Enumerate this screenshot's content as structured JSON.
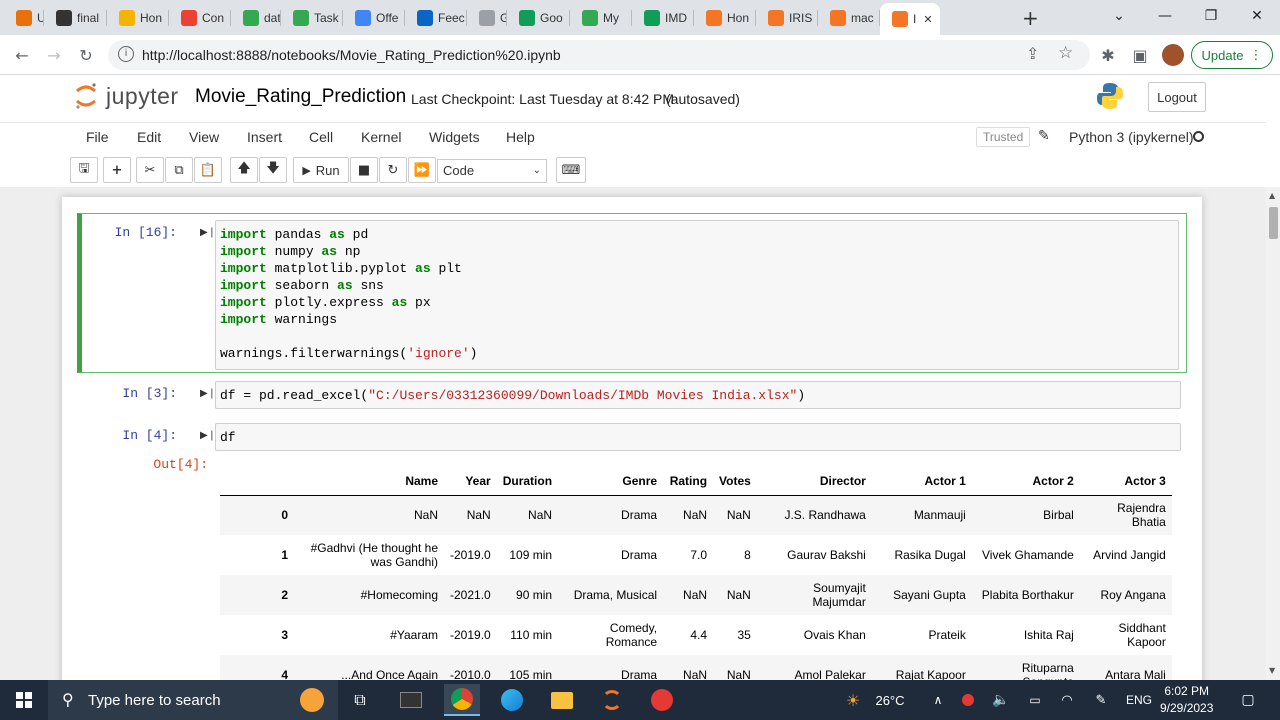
{
  "browser": {
    "tabs": [
      {
        "label": "Unti",
        "icon": "colab-icon",
        "color": "#e8710a"
      },
      {
        "label": "final",
        "icon": "github-icon",
        "color": "#333333"
      },
      {
        "label": "Hon",
        "icon": "sheet-icon",
        "color": "#f4b400"
      },
      {
        "label": "Con",
        "icon": "gmail-icon",
        "color": "#ea4335"
      },
      {
        "label": "data",
        "icon": "drive-icon",
        "color": "#34a853"
      },
      {
        "label": "Task",
        "icon": "drive-icon",
        "color": "#34a853"
      },
      {
        "label": "Offe",
        "icon": "drive-icon",
        "color": "#4285f4"
      },
      {
        "label": "Feec",
        "icon": "linkedin-icon",
        "color": "#0a66c2"
      },
      {
        "label": "Grou",
        "icon": "globe-icon",
        "color": "#9aa0a6"
      },
      {
        "label": "Goo",
        "icon": "google-sheets-icon",
        "color": "#0f9d58"
      },
      {
        "label": "My",
        "icon": "drive-icon",
        "color": "#34a853"
      },
      {
        "label": "IMD",
        "icon": "google-sheets-icon",
        "color": "#0f9d58"
      },
      {
        "label": "Hon",
        "icon": "jupyter-icon",
        "color": "#f37626"
      },
      {
        "label": "IRIS",
        "icon": "folder-icon",
        "color": "#f37626"
      },
      {
        "label": "mac",
        "icon": "folder-icon",
        "color": "#f37626"
      },
      {
        "label": "I",
        "icon": "folder-icon",
        "color": "#f37626"
      }
    ],
    "url": "http://localhost:8888/notebooks/Movie_Rating_Prediction%20.ipynb",
    "update_label": "Update"
  },
  "jupyter": {
    "logo_text": "jupyter",
    "notebook_name": "Movie_Rating_Prediction",
    "checkpoint": "Last Checkpoint: Last Tuesday at 8:42 PM",
    "autosave": "(autosaved)",
    "logout_label": "Logout",
    "menu": [
      "File",
      "Edit",
      "View",
      "Insert",
      "Cell",
      "Kernel",
      "Widgets",
      "Help"
    ],
    "trusted_label": "Trusted",
    "kernel_name": "Python 3 (ipykernel)",
    "run_label": "Run",
    "cell_type": "Code"
  },
  "cells": {
    "c1": {
      "prompt": "In [16]:"
    },
    "c2": {
      "prompt": "In [3]:"
    },
    "c3": {
      "prompt": "In [4]:",
      "code": "df",
      "out_prompt": "Out[4]:"
    }
  },
  "dataframe": {
    "columns": [
      "",
      "Name",
      "Year",
      "Duration",
      "Genre",
      "Rating",
      "Votes",
      "Director",
      "Actor 1",
      "Actor 2",
      "Actor 3"
    ],
    "rows": [
      [
        "0",
        "NaN",
        "NaN",
        "NaN",
        "Drama",
        "NaN",
        "NaN",
        "J.S. Randhawa",
        "Manmauji",
        "Birbal",
        "Rajendra Bhatia"
      ],
      [
        "1",
        "#Gadhvi (He thought he was Gandhi)",
        "-2019.0",
        "109 min",
        "Drama",
        "7.0",
        "8",
        "Gaurav Bakshi",
        "Rasika Dugal",
        "Vivek Ghamande",
        "Arvind Jangid"
      ],
      [
        "2",
        "#Homecoming",
        "-2021.0",
        "90 min",
        "Drama, Musical",
        "NaN",
        "NaN",
        "Soumyajit Majumdar",
        "Sayani Gupta",
        "Plabita Borthakur",
        "Roy Angana"
      ],
      [
        "3",
        "#Yaaram",
        "-2019.0",
        "110 min",
        "Comedy, Romance",
        "4.4",
        "35",
        "Ovais Khan",
        "Prateik",
        "Ishita Raj",
        "Siddhant Kapoor"
      ],
      [
        "4",
        "...And Once Again",
        "-2010.0",
        "105 min",
        "Drama",
        "NaN",
        "NaN",
        "Amol Palekar",
        "Rajat Kapoor",
        "Rituparna Sengupta",
        "Antara Mali"
      ]
    ]
  },
  "taskbar": {
    "search_placeholder": "Type here to search",
    "temperature": "26°C",
    "language": "ENG",
    "time": "6:02 PM",
    "date": "9/29/2023"
  }
}
